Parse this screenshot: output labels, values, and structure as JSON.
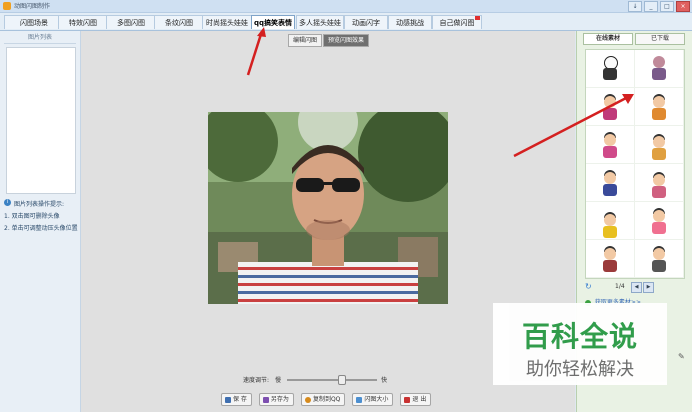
{
  "window": {
    "title": "动图闪图制作",
    "buttons": [
      "↓",
      "_",
      "□",
      "×"
    ]
  },
  "tabs": [
    {
      "label": "闪图场景",
      "active": false
    },
    {
      "label": "特效闪图",
      "active": false
    },
    {
      "label": "多图闪图",
      "active": false
    },
    {
      "label": "条纹闪图",
      "active": false
    },
    {
      "label": "时尚摇头娃娃",
      "active": false
    },
    {
      "label": "qq搞笑表情",
      "active": true
    },
    {
      "label": "多人摇头娃娃",
      "active": false
    },
    {
      "label": "动画闪字",
      "active": false
    },
    {
      "label": "动感挑战",
      "active": false
    },
    {
      "label": "自己做闪图",
      "active": false,
      "badge": true
    }
  ],
  "left_panel": {
    "title": "图片列表",
    "tips_heading": "图片列表操作提示:",
    "tips": [
      "1. 双击图可删除头像",
      "2. 单击可调整动压头像位置"
    ]
  },
  "center": {
    "view_tabs": [
      {
        "label": "编辑闪图",
        "active": false
      },
      {
        "label": "预览闪图效果",
        "active": true
      }
    ],
    "speed": {
      "label": "速度调节:",
      "slow": "慢",
      "fast": "快",
      "value": 0.6
    },
    "buttons": [
      {
        "label": "保 存",
        "icon": "save-icon",
        "color": "#3f6fb0"
      },
      {
        "label": "另存为",
        "icon": "save-as-icon",
        "color": "#7d4fb0"
      },
      {
        "label": "复制到QQ",
        "icon": "qq-icon",
        "color": "#d68a1c"
      },
      {
        "label": "闪图大小",
        "icon": "size-icon",
        "color": "#4c8fd0"
      },
      {
        "label": "退 出",
        "icon": "exit-icon",
        "color": "#c83232"
      }
    ]
  },
  "right_panel": {
    "tabs": [
      {
        "label": "在线素材",
        "active": true
      },
      {
        "label": "已下载",
        "active": false
      }
    ],
    "sticker_captions": [
      "",
      "",
      "",
      "",
      "",
      "",
      "",
      "",
      "",
      "",
      "",
      ""
    ],
    "pager": {
      "page": "1/4",
      "prev": "◀",
      "next": "▶"
    },
    "more_link": "获取更多素材>>"
  },
  "watermark": {
    "title": "百科全说",
    "subtitle": "助你轻松解决"
  },
  "colors": {
    "arrow": "#d42020",
    "accent": "#2a9a45",
    "tab_active": "#ffffff"
  }
}
